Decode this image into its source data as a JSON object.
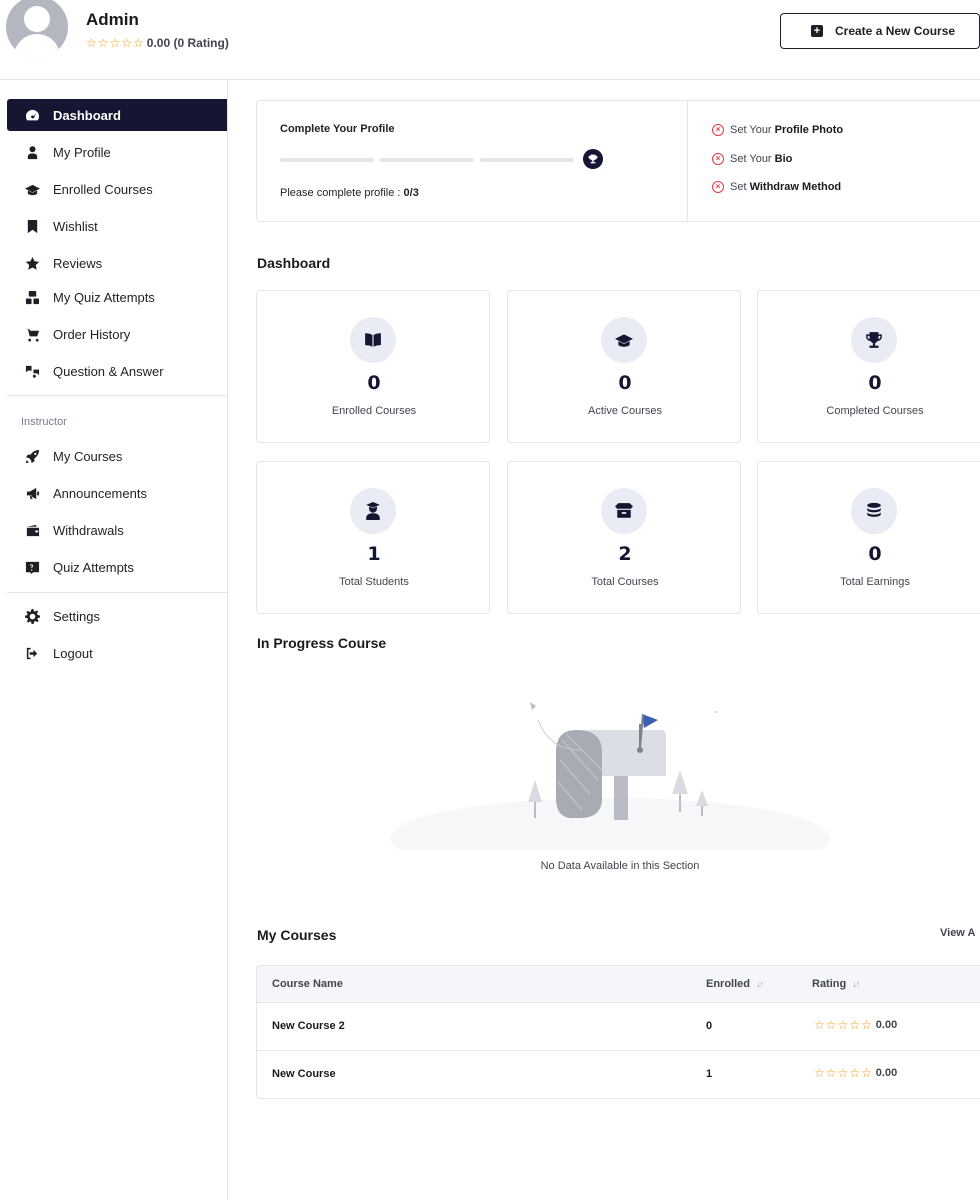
{
  "header": {
    "user_name": "Admin",
    "user_rating_stars": "☆☆☆☆☆",
    "user_rating_text": "0.00 (0 Rating)",
    "create_course_label": "Create a New Course"
  },
  "sidebar": {
    "items": [
      {
        "label": "Dashboard",
        "icon": "dashboard-icon"
      },
      {
        "label": "My Profile",
        "icon": "user-icon"
      },
      {
        "label": "Enrolled Courses",
        "icon": "graduation-cap-icon"
      },
      {
        "label": "Wishlist",
        "icon": "bookmark-icon"
      },
      {
        "label": "Reviews",
        "icon": "star-icon"
      },
      {
        "label": "My Quiz Attempts",
        "icon": "quiz-icon"
      },
      {
        "label": "Order History",
        "icon": "cart-icon"
      },
      {
        "label": "Question & Answer",
        "icon": "qa-icon"
      }
    ],
    "instructor_label": "Instructor",
    "instructor_items": [
      {
        "label": "My Courses",
        "icon": "rocket-icon"
      },
      {
        "label": "Announcements",
        "icon": "megaphone-icon"
      },
      {
        "label": "Withdrawals",
        "icon": "wallet-icon"
      },
      {
        "label": "Quiz Attempts",
        "icon": "question-box-icon"
      }
    ],
    "bottom_items": [
      {
        "label": "Settings",
        "icon": "gear-icon"
      },
      {
        "label": "Logout",
        "icon": "logout-icon"
      }
    ]
  },
  "profile": {
    "title": "Complete Your Profile",
    "progress_completed": 0,
    "progress_total": 3,
    "note_label": "Please complete profile :",
    "note_value": "0/3",
    "checklist": [
      {
        "prefix": "Set Your",
        "bold": "Profile Photo"
      },
      {
        "prefix": "Set Your",
        "bold": "Bio"
      },
      {
        "prefix": "Set",
        "bold": "Withdraw Method"
      }
    ]
  },
  "dashboard": {
    "title": "Dashboard",
    "stats": [
      {
        "value": "0",
        "label": "Enrolled Courses",
        "icon": "book-icon"
      },
      {
        "value": "0",
        "label": "Active Courses",
        "icon": "graduation-cap-icon"
      },
      {
        "value": "0",
        "label": "Completed Courses",
        "icon": "trophy-icon"
      },
      {
        "value": "1",
        "label": "Total Students",
        "icon": "student-icon"
      },
      {
        "value": "2",
        "label": "Total Courses",
        "icon": "box-icon"
      },
      {
        "value": "0",
        "label": "Total Earnings",
        "icon": "coins-icon"
      }
    ]
  },
  "in_progress": {
    "title": "In Progress Course",
    "empty_text": "No Data Available in this Section"
  },
  "my_courses": {
    "title": "My Courses",
    "view_all": "View A",
    "columns": {
      "name": "Course Name",
      "enrolled": "Enrolled",
      "rating": "Rating"
    },
    "rows": [
      {
        "name": "New Course 2",
        "enrolled": "0",
        "stars": "☆☆☆☆☆",
        "rating": "0.00"
      },
      {
        "name": "New Course",
        "enrolled": "1",
        "stars": "☆☆☆☆☆",
        "rating": "0.00"
      }
    ]
  },
  "colors": {
    "accent": "#141632",
    "star": "#ed9700",
    "error": "#e63946"
  }
}
